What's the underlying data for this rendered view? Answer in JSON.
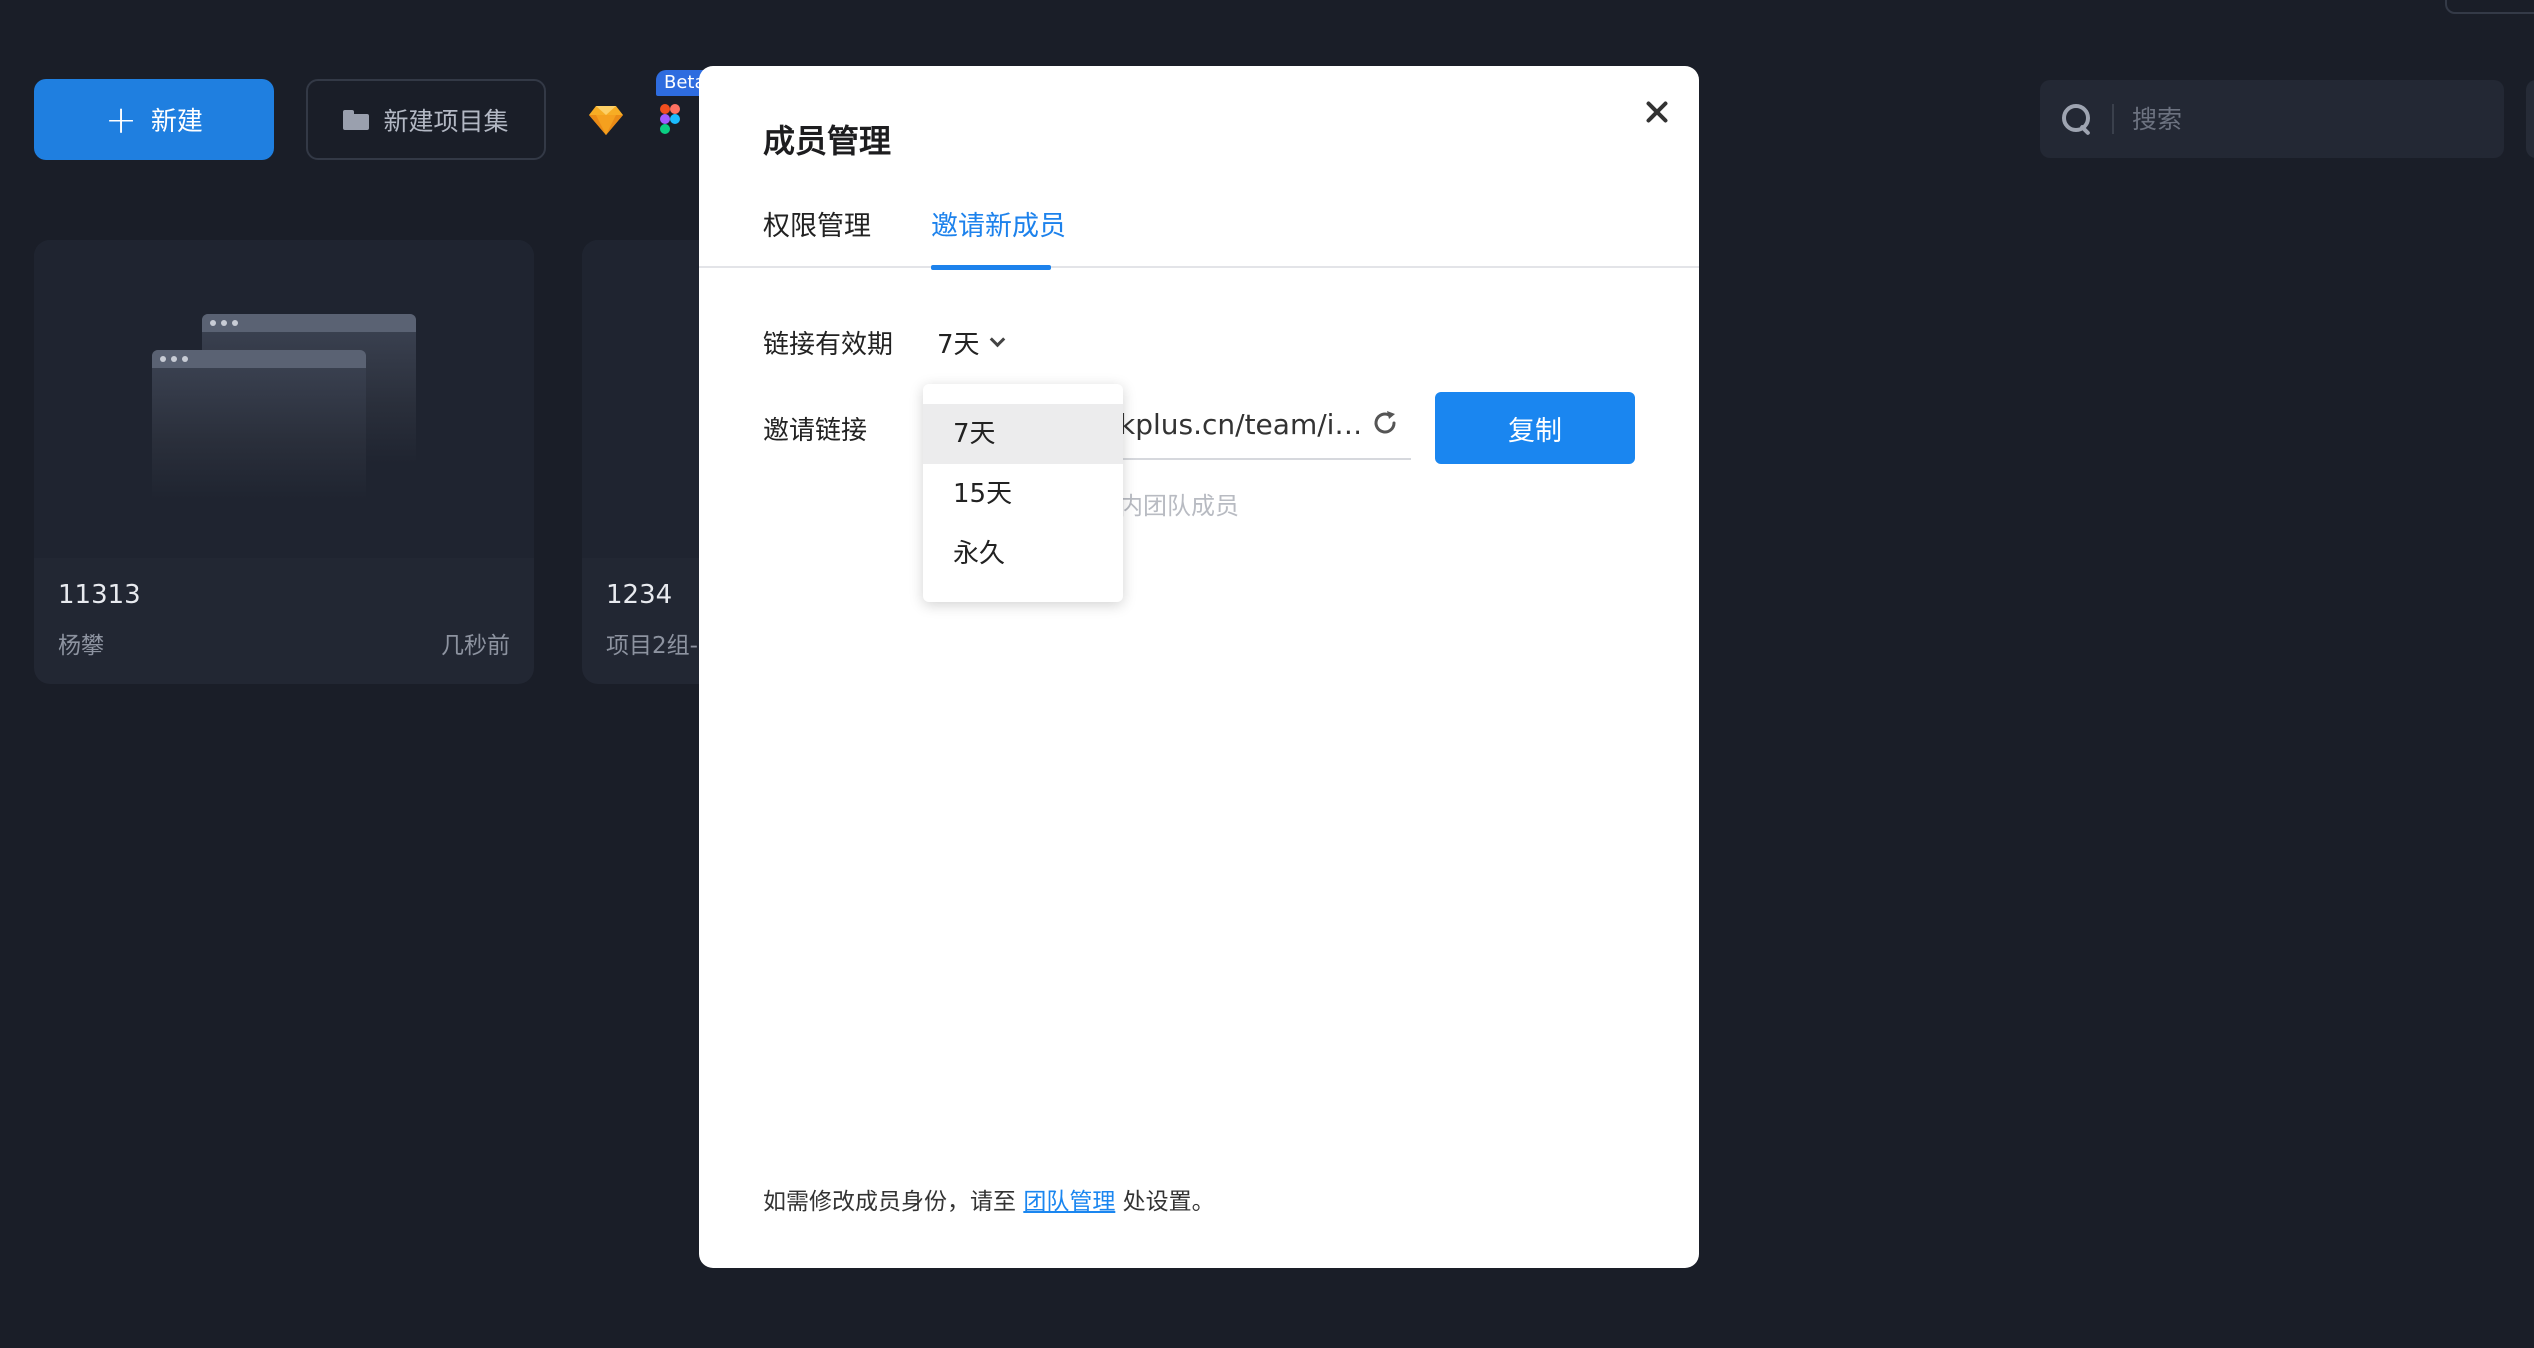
{
  "background": {
    "toolbar": {
      "new_label": "新建",
      "new_collection_label": "新建项目集",
      "beta_badge": "Beta",
      "sketch_icon": "sketch-diamond-icon",
      "figma_icon": "figma-logo-icon"
    },
    "search": {
      "placeholder": "搜索"
    },
    "cards": [
      {
        "title": "11313",
        "owner": "杨攀",
        "time": "几秒前"
      },
      {
        "title": "1234",
        "owner": "项目2组-",
        "time": ""
      }
    ]
  },
  "modal": {
    "title": "成员管理",
    "close_icon": "close-icon",
    "tabs": [
      {
        "label": "权限管理",
        "active": false
      },
      {
        "label": "邀请新成员",
        "active": true
      }
    ],
    "expiry": {
      "label": "链接有效期",
      "selected": "7天",
      "options": [
        "7天",
        "15天",
        "永久"
      ]
    },
    "invite_link": {
      "label": "邀请链接",
      "value": "kplus.cn/team/i…",
      "hint": "内团队成员",
      "copy_label": "复制"
    },
    "footer": {
      "prefix": "如需修改成员身份，请至 ",
      "link": "团队管理",
      "suffix": " 处设置。"
    }
  },
  "colors": {
    "background": "#1a1e28",
    "accent": "#1a86f0",
    "modal": "#ffffff"
  }
}
